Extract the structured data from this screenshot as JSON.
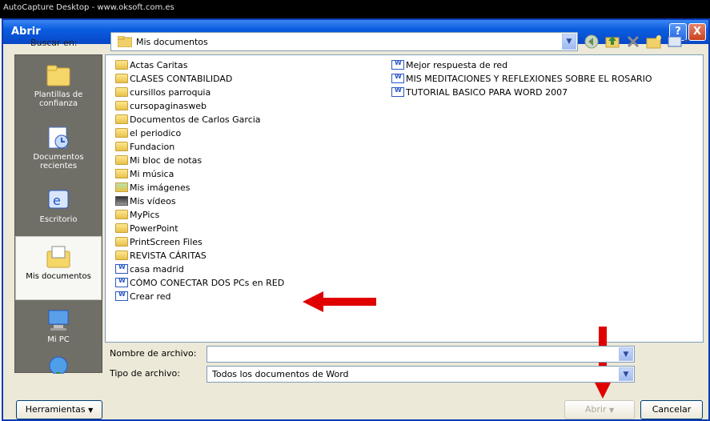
{
  "capture_bar": {
    "text": "AutoCapture Desktop - www.oksoft.com.es"
  },
  "dialog": {
    "title": "Abrir",
    "help_label": "?",
    "close_label": "X"
  },
  "lookin": {
    "label": "Buscar en:",
    "value": "Mis documentos",
    "arrow": "▼"
  },
  "toolbar_icons": [
    "back-icon",
    "up-folder-icon",
    "delete-icon",
    "new-folder-icon",
    "views-icon"
  ],
  "places": [
    {
      "label": "Plantillas de confianza",
      "icon": "trusted-templates-icon"
    },
    {
      "label": "Documentos recientes",
      "icon": "recent-documents-icon"
    },
    {
      "label": "Escritorio",
      "icon": "desktop-icon"
    },
    {
      "label": "Mis documentos",
      "icon": "my-documents-icon",
      "active": true
    },
    {
      "label": "Mi PC",
      "icon": "my-computer-icon"
    },
    {
      "label": "",
      "icon": "network-places-icon"
    }
  ],
  "files_col1": [
    {
      "name": "Actas Caritas",
      "type": "folder"
    },
    {
      "name": "CLASES CONTABILIDAD",
      "type": "folder"
    },
    {
      "name": "cursillos parroquia",
      "type": "folder"
    },
    {
      "name": "cursopaginasweb",
      "type": "folder"
    },
    {
      "name": "Documentos de Carlos Garcia",
      "type": "folder"
    },
    {
      "name": "el periodico",
      "type": "folder"
    },
    {
      "name": "Fundacion",
      "type": "folder"
    },
    {
      "name": "Mi bloc de notas",
      "type": "folder"
    },
    {
      "name": "Mi música",
      "type": "music"
    },
    {
      "name": "Mis imágenes",
      "type": "pics"
    },
    {
      "name": "Mis vídeos",
      "type": "video"
    },
    {
      "name": "MyPics",
      "type": "folder"
    },
    {
      "name": "PowerPoint",
      "type": "folder"
    },
    {
      "name": "PrintScreen Files",
      "type": "folder"
    },
    {
      "name": "REVISTA CÁRITAS",
      "type": "folder"
    },
    {
      "name": "casa madrid",
      "type": "doc"
    },
    {
      "name": "CÓMO CONECTAR DOS PCs en RED",
      "type": "doc"
    },
    {
      "name": "Crear red",
      "type": "doc"
    }
  ],
  "files_col2": [
    {
      "name": "Mejor respuesta de red",
      "type": "doc"
    },
    {
      "name": "MIS MEDITACIONES Y REFLEXIONES SOBRE EL ROSARIO",
      "type": "doc"
    },
    {
      "name": "TUTORIAL BASICO PARA WORD 2007",
      "type": "doc"
    }
  ],
  "filename": {
    "label": "Nombre de archivo:",
    "value": ""
  },
  "filetype": {
    "label": "Tipo de archivo:",
    "value": "Todos los documentos de Word"
  },
  "buttons": {
    "tools": "Herramientas",
    "open": "Abrir",
    "cancel": "Cancelar",
    "dropdown_arrow": "▼"
  },
  "colors": {
    "titlebar": "#0a5ce0",
    "arrow": "#e00000",
    "places_bg": "#6f6e67"
  }
}
